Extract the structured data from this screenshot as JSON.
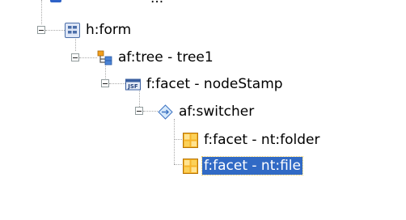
{
  "tree": {
    "clipped_label": "...",
    "nodes": [
      {
        "label": "h:form",
        "icon": "form-icon"
      },
      {
        "label": "af:tree - tree1",
        "icon": "tree-icon"
      },
      {
        "label": "f:facet - nodeStamp",
        "icon": "jsf-icon"
      },
      {
        "label": "af:switcher",
        "icon": "switcher-icon"
      },
      {
        "label": "f:facet - nt:folder",
        "icon": "facet-grid-icon"
      },
      {
        "label": "f:facet - nt:file",
        "icon": "facet-grid-icon",
        "selected": true
      }
    ],
    "colors": {
      "selection_bg": "#316ac5",
      "selection_text": "#ffffff",
      "guide_lines": "#a9a9a9"
    }
  }
}
